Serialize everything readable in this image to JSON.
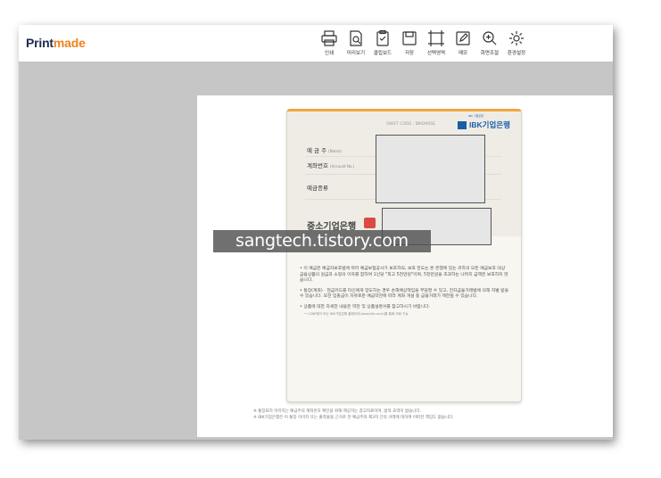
{
  "app": {
    "logo_part1": "Print",
    "logo_part2": "made"
  },
  "toolbar": {
    "items": [
      {
        "label": "인쇄",
        "icon": "printer-icon"
      },
      {
        "label": "미리보기",
        "icon": "preview-icon"
      },
      {
        "label": "클립보드",
        "icon": "clipboard-icon"
      },
      {
        "label": "저장",
        "icon": "save-icon"
      },
      {
        "label": "선택영역",
        "icon": "selection-icon"
      },
      {
        "label": "메모",
        "icon": "memo-icon"
      },
      {
        "label": "화면조절",
        "icon": "zoom-icon"
      },
      {
        "label": "환경설정",
        "icon": "gear-icon"
      }
    ]
  },
  "bankbook": {
    "swift": "SWIFT CODE : IBKOKRSE",
    "bank_name": "IBK기업은행",
    "bank_tag": "IBK 기업은행",
    "fields": {
      "holder_label": "예 금 주",
      "holder_sub": "(Name)",
      "account_label": "계좌번호",
      "account_sub": "(Account No.)",
      "type_label": "예금종류"
    },
    "product": "중소기업은행",
    "notes": [
      "• 이 예금은 예금자보호법에 따라 예금보험공사가 보호하되, 보호 한도는 본 은행에 있는 귀하의 모든 예금보호 대상 금융상품의 원금과 소정의 이자를 합하여 1인당 \"최고 5천만원\"이며, 5천만원을 초과하는 나머지 금액은 보호하지 않습니다.",
      "• 통장(계좌) · 현금카드를 타인에게 양도하는 경우 손해배상책임을 부담할 수 있고, 전자금융거래법에 의해 처벌 받을 수 있습니다. 또한 입출금이 자유로운 예금약관에 따라 계좌 개설 등 금융거래가 제한될 수 있습니다.",
      "• 상품에 대한 자세한 내용은 약관 및 상품설명서를 참고하시기 바랍니다."
    ],
    "note_small": "• i-ONE뱅크 또는 IBK기업은행 홈페이지(www.ibk.co.kr)를 통해 조회 가능"
  },
  "footer": [
    "※ 통장표지 이미지는 예금주의 계좌번호 확인을 위해 제공하는 참고자료이며, 법적 효력이 없습니다.",
    "※ IBK기업은행은 이 통장 이미지 또는 출력물을 근거로 한 예금주와 제3자 간의 거래에 대하여 어떠한 책임도 없습니다."
  ],
  "watermark": "sangtech.tistory.com",
  "colors": {
    "brand_orange": "#f0821e",
    "ibk_blue": "#1b5ea8",
    "background": "#c6c6c6"
  }
}
